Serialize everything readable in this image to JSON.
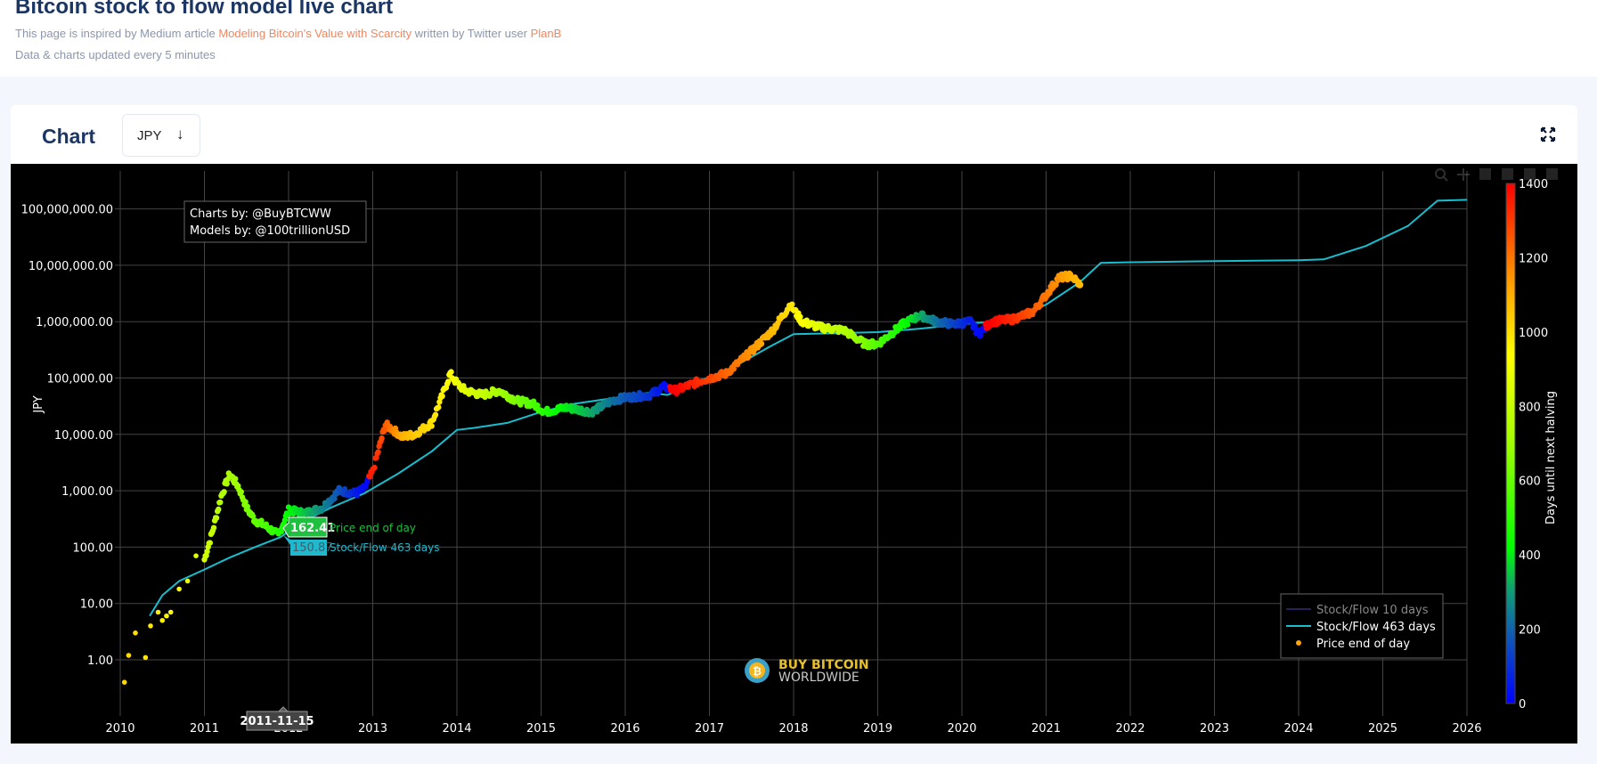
{
  "header": {
    "title": "Bitcoin stock to flow model live chart",
    "intro_prefix": "This page is inspired by Medium article ",
    "article_link": "Modeling Bitcoin's Value with Scarcity",
    "intro_middle": " written by Twitter user ",
    "author_link": "PlanB",
    "update_note": "Data & charts updated every 5 minutes"
  },
  "card": {
    "label": "Chart",
    "currency_select": {
      "value": "JPY",
      "icon": "arrow-down-icon"
    },
    "expand_icon": "expand-icon"
  },
  "toolbar": [
    "zoom-icon",
    "pan-icon",
    "zoom-in-icon",
    "zoom-out-icon",
    "autoscale-icon",
    "reset-axes-icon"
  ],
  "colors": {
    "background": "#000000",
    "model_463": "#17becf",
    "model_10": "#2a1f5a",
    "grid": "#444444",
    "accent": "#f2865f",
    "title": "#1c3664"
  },
  "chart_data": {
    "type": "scatter",
    "title": "",
    "xlabel": "",
    "ylabel": "JPY",
    "yscale": "log",
    "ylim": [
      0.3,
      200000000
    ],
    "xlim": [
      2010,
      2026
    ],
    "x_ticks": [
      "2010",
      "2011",
      "2012",
      "2013",
      "2014",
      "2015",
      "2016",
      "2017",
      "2018",
      "2019",
      "2020",
      "2021",
      "2022",
      "2023",
      "2024",
      "2025",
      "2026"
    ],
    "y_ticks": [
      {
        "value": 1,
        "label": "1.00"
      },
      {
        "value": 10,
        "label": "10.00"
      },
      {
        "value": 100,
        "label": "100.00"
      },
      {
        "value": 1000,
        "label": "1,000.00"
      },
      {
        "value": 10000,
        "label": "10,000.00"
      },
      {
        "value": 100000,
        "label": "100,000.00"
      },
      {
        "value": 1000000,
        "label": "1,000,000.00"
      },
      {
        "value": 10000000,
        "label": "10,000,000.00"
      },
      {
        "value": 100000000,
        "label": "100,000,000.00"
      }
    ],
    "grid": true,
    "annotation": [
      "Charts by: @BuyBTCWW",
      "Models by: @100trillionUSD"
    ],
    "legend": {
      "placement": "bottom-right",
      "entries": [
        {
          "name": "Stock/Flow 10 days",
          "type": "line",
          "color": "#2a1f5a",
          "hidden": true
        },
        {
          "name": "Stock/Flow 463 days",
          "type": "line",
          "color": "#17becf"
        },
        {
          "name": "Price end of day",
          "type": "marker",
          "color": "#ffa500"
        }
      ]
    },
    "colorbar": {
      "title": "Days until next halving",
      "range": [
        0,
        1400
      ],
      "ticks": [
        0,
        200,
        400,
        600,
        800,
        1000,
        1200,
        1400
      ],
      "colorscale": [
        [
          0,
          "#0000ff"
        ],
        [
          0.14,
          "#1060b0"
        ],
        [
          0.22,
          "#10a070"
        ],
        [
          0.3,
          "#00ff00"
        ],
        [
          0.5,
          "#a0ff00"
        ],
        [
          0.67,
          "#ffff00"
        ],
        [
          0.8,
          "#ffa500"
        ],
        [
          1,
          "#ff0000"
        ]
      ]
    },
    "hover": {
      "date": "2011-11-15",
      "price_label": "162.41",
      "price_series": "Price end of day",
      "model_label": "150.87",
      "model_series": "Stock/Flow 463 days"
    },
    "series": [
      {
        "name": "Stock/Flow 463 days",
        "x": [
          2010.35,
          2010.5,
          2010.7,
          2011.0,
          2011.3,
          2011.6,
          2011.9,
          2012.2,
          2012.5,
          2012.9,
          2013.3,
          2013.7,
          2014.0,
          2014.2,
          2014.6,
          2015.0,
          2015.4,
          2015.9,
          2016.3,
          2016.5,
          2016.9,
          2017.3,
          2017.7,
          2018.0,
          2018.5,
          2019.0,
          2019.5,
          2020.0,
          2020.3,
          2020.6,
          2021.0,
          2021.4,
          2021.65,
          2022.0,
          2023.0,
          2024.0,
          2024.3,
          2024.8,
          2025.3,
          2025.65,
          2026.0
        ],
        "y": [
          6,
          14,
          25,
          40,
          65,
          100,
          150,
          300,
          500,
          900,
          2000,
          5000,
          12000,
          13000,
          16000,
          25000,
          35000,
          45000,
          55000,
          50000,
          90000,
          160000,
          350000,
          600000,
          620000,
          650000,
          750000,
          900000,
          980000,
          1100000,
          2000000,
          5000000,
          11000000,
          11300000,
          11800000,
          12300000,
          12700000,
          22000000,
          50000000,
          140000000,
          145000000
        ]
      },
      {
        "name": "Price end of day",
        "x": [
          2010.05,
          2010.1,
          2010.18,
          2010.3,
          2010.36,
          2010.45,
          2010.5,
          2010.55,
          2010.6,
          2010.7,
          2010.8,
          2010.9,
          2011.0,
          2011.1,
          2011.2,
          2011.3,
          2011.4,
          2011.45,
          2011.5,
          2011.6,
          2011.7,
          2011.8,
          2011.88,
          2012.0,
          2012.2,
          2012.4,
          2012.6,
          2012.8,
          2012.9,
          2013.0,
          2013.15,
          2013.28,
          2013.35,
          2013.5,
          2013.7,
          2013.85,
          2013.92,
          2014.0,
          2014.1,
          2014.3,
          2014.5,
          2014.7,
          2014.9,
          2015.05,
          2015.3,
          2015.6,
          2015.85,
          2016.0,
          2016.3,
          2016.45,
          2016.6,
          2016.9,
          2017.2,
          2017.5,
          2017.75,
          2017.96,
          2018.1,
          2018.3,
          2018.6,
          2018.85,
          2019.0,
          2019.3,
          2019.5,
          2019.7,
          2019.9,
          2020.1,
          2020.2,
          2020.35,
          2020.6,
          2020.85,
          2021.0,
          2021.15,
          2021.3,
          2021.4
        ],
        "y": [
          0.4,
          1.2,
          3,
          1.1,
          4,
          7,
          5,
          6,
          7,
          18,
          25,
          70,
          60,
          200,
          800,
          2000,
          1200,
          800,
          500,
          300,
          250,
          200,
          162,
          450,
          400,
          500,
          1000,
          900,
          1100,
          2200,
          15000,
          11000,
          9000,
          10000,
          16000,
          60000,
          120000,
          80000,
          60000,
          50000,
          60000,
          40000,
          35000,
          25000,
          30000,
          25000,
          40000,
          45000,
          50000,
          70000,
          60000,
          90000,
          120000,
          300000,
          700000,
          2000000,
          1000000,
          800000,
          700000,
          400000,
          400000,
          900000,
          1300000,
          1000000,
          900000,
          1000000,
          600000,
          1000000,
          1100000,
          1500000,
          3000000,
          6000000,
          6500000,
          4500000
        ],
        "color_value": [
          1020,
          1015,
          1005,
          990,
          980,
          970,
          960,
          950,
          940,
          920,
          890,
          860,
          830,
          790,
          750,
          720,
          690,
          670,
          640,
          600,
          560,
          520,
          490,
          420,
          350,
          270,
          170,
          60,
          20,
          1350,
          1250,
          1150,
          1100,
          1050,
          1000,
          960,
          940,
          900,
          860,
          800,
          720,
          640,
          560,
          480,
          400,
          320,
          230,
          180,
          100,
          30,
          1400,
          1320,
          1230,
          1150,
          1080,
          1000,
          930,
          860,
          750,
          640,
          560,
          450,
          330,
          230,
          140,
          60,
          20,
          1400,
          1330,
          1250,
          1200,
          1150,
          1100,
          1080
        ]
      }
    ]
  }
}
